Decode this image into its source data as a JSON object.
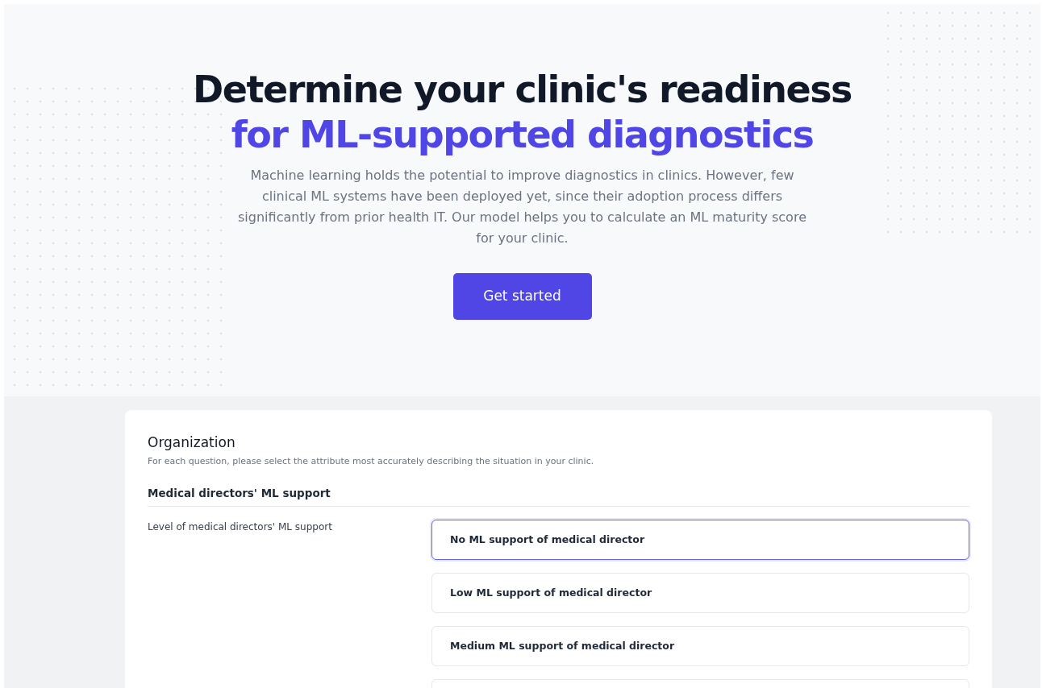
{
  "hero": {
    "title_line_1": "Determine your clinic's readiness",
    "title_line_2": "for ML-supported diagnostics",
    "description": "Machine learning holds the potential to improve diagnostics in clinics. However, few clinical ML systems have been deployed yet, since their adoption process differs significantly from prior health IT. Our model helps you to calculate an ML maturity score for your clinic.",
    "button": "Get started"
  },
  "section": {
    "title": "Organization",
    "description": "For each question, please select the attribute most accurately describing the situation in your clinic.",
    "group": "Medical directors' ML support",
    "question": "Level of medical directors' ML support",
    "options": [
      {
        "label": "No ML support of medical director",
        "selected": true
      },
      {
        "label": "Low ML support of medical director",
        "selected": false
      },
      {
        "label": "Medium ML support of medical director",
        "selected": false
      }
    ]
  }
}
